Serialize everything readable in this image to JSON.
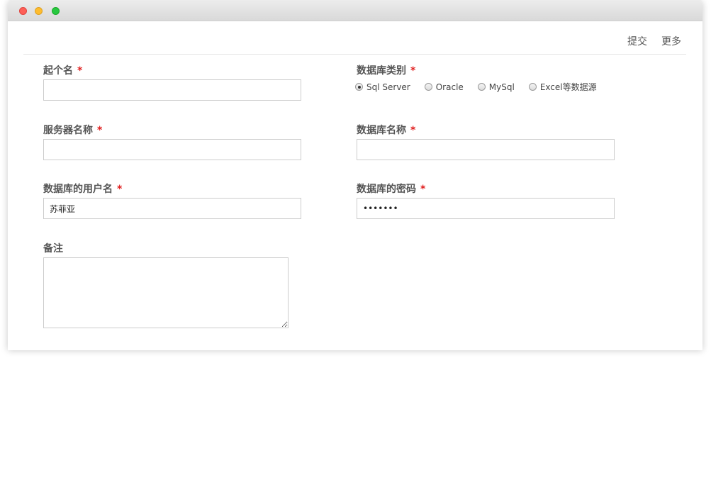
{
  "window": {
    "traffic_lights": [
      "close-button",
      "minimize-button",
      "zoom-button"
    ]
  },
  "toolbar": {
    "submit_label": "提交",
    "more_label": "更多"
  },
  "form": {
    "name": {
      "label": "起个名",
      "required_mark": "*",
      "value": ""
    },
    "db_type": {
      "label": "数据库类别",
      "required_mark": "*",
      "options": [
        "Sql Server",
        "Oracle",
        "MySql",
        "Excel等数据源"
      ],
      "selected": "Sql Server"
    },
    "server_name": {
      "label": "服务器名称",
      "required_mark": "*",
      "value": ""
    },
    "db_name": {
      "label": "数据库名称",
      "required_mark": "*",
      "value": ""
    },
    "db_user": {
      "label": "数据库的用户名",
      "required_mark": "*",
      "value": "苏菲亚"
    },
    "db_password": {
      "label": "数据库的密码",
      "required_mark": "*",
      "value": "•••••••"
    },
    "remark": {
      "label": "备注",
      "value": ""
    }
  }
}
